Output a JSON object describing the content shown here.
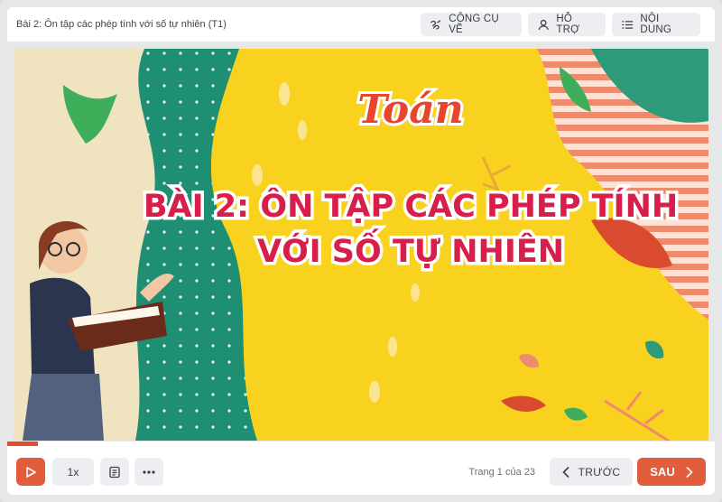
{
  "header": {
    "lesson_title": "Bài 2: Ôn tập các phép tính với số tự nhiên (T1)",
    "tools_label": "CÔNG CỤ VẼ",
    "support_label": "HỖ TRỢ",
    "contents_label": "NỘI DUNG"
  },
  "slide": {
    "subject": "Toán",
    "title_line1": "BÀI 2: ÔN TẬP CÁC PHÉP TÍNH",
    "title_line2": "VỚI SỐ TỰ NHIÊN"
  },
  "progress": {
    "fraction": 0.0435
  },
  "footer": {
    "speed_label": "1x",
    "page_info": "Trang 1 của 23",
    "prev_label": "TRƯỚC",
    "next_label": "SAU"
  },
  "colors": {
    "accent": "#e15d3b",
    "slide_yellow": "#f9d21f",
    "slide_green": "#1f8f73"
  },
  "icons": [
    "pen-tools-icon",
    "user-icon",
    "list-icon",
    "play-icon",
    "notes-icon",
    "more-icon",
    "chevron-left-icon",
    "chevron-right-icon"
  ]
}
